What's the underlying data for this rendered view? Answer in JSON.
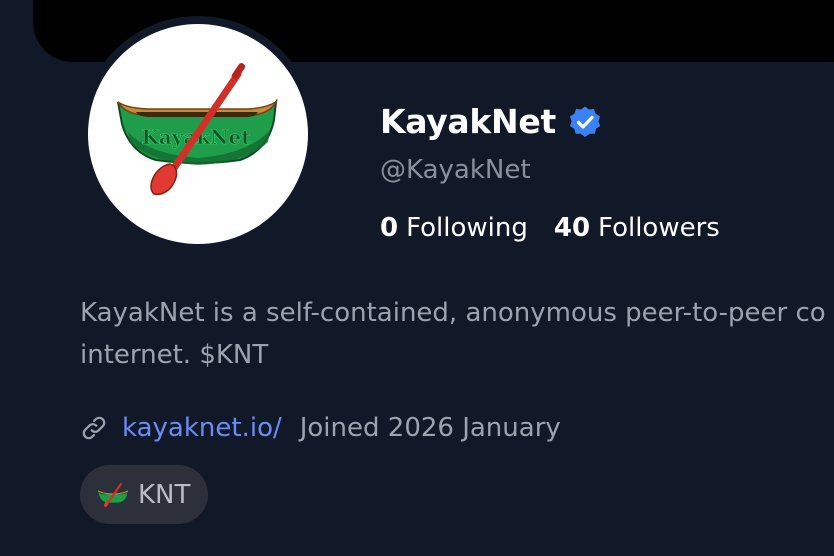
{
  "profile": {
    "display_name": "KayakNet",
    "handle": "@KayakNet",
    "verified_icon": "verified-badge-icon",
    "avatar_icon": "canoe-paddle-icon",
    "avatar_logo_text": "KayakNet",
    "following_count": "0",
    "following_label": "Following",
    "followers_count": "40",
    "followers_label": "Followers",
    "bio_line1": "KayakNet is a self-contained, anonymous peer-to-peer co",
    "bio_line2": "internet. $KNT",
    "link_icon": "link-icon",
    "website": "kayaknet.io/",
    "joined": "Joined 2026 January",
    "token_icon": "canoe-icon",
    "token_label": "KNT"
  },
  "colors": {
    "background": "#111827",
    "banner": "#000000",
    "verified": "#3b82f6",
    "link": "#6b8cf5",
    "secondary_text": "#9ca3af",
    "pill": "#2d2f3a",
    "canoe_green": "#1f9d4a",
    "paddle_red": "#e03a32"
  }
}
